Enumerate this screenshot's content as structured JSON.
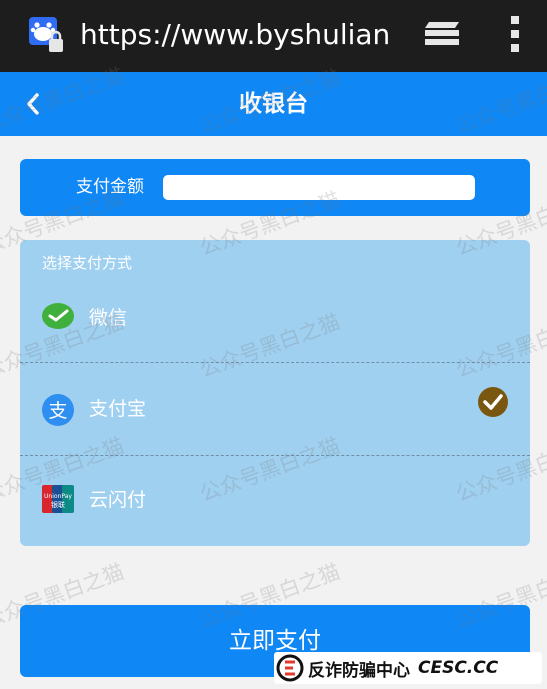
{
  "browser": {
    "url": "https://www.byshulian.com",
    "site_icon": "baidu-lock-icon",
    "tabs_icon": "tabs-icon",
    "menu_icon": "more-vert-icon"
  },
  "header": {
    "title": "收银台",
    "back_icon": "chevron-left-icon",
    "color": "#0f87f5"
  },
  "amount": {
    "label": "支付金额",
    "value": "",
    "placeholder": ""
  },
  "payment": {
    "heading": "选择支付方式",
    "options": [
      {
        "label": "微信",
        "icon": "wechat-pay-icon",
        "selected": false
      },
      {
        "label": "支付宝",
        "icon": "alipay-icon",
        "selected": true
      },
      {
        "label": "云闪付",
        "icon": "unionpay-icon",
        "selected": false
      }
    ],
    "selected_icon": "check-circle-icon",
    "card_color": "#a0d0f0"
  },
  "submit": {
    "label": "立即支付"
  },
  "badge": {
    "text": "反诈防骗中心",
    "site": "CESC.CC"
  },
  "watermark": "公众号黑白之猫"
}
